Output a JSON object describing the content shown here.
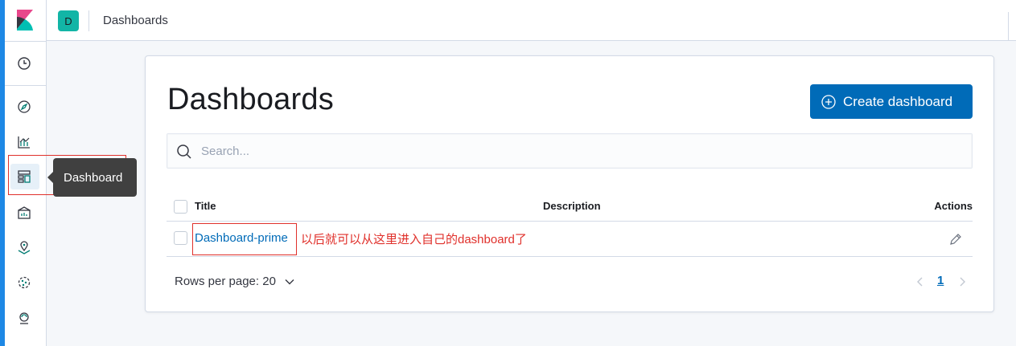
{
  "header": {
    "space_avatar_letter": "D",
    "breadcrumb": "Dashboards"
  },
  "nav": {
    "tooltip": "Dashboard",
    "icons": [
      "clock-icon",
      "compass-icon",
      "visualize-icon",
      "dashboard-icon",
      "canvas-icon",
      "maps-icon",
      "ml-icon",
      "metrics-icon"
    ]
  },
  "main": {
    "title": "Dashboards",
    "create_button": "Create dashboard",
    "search_placeholder": "Search...",
    "table": {
      "columns": [
        "Title",
        "Description",
        "Actions"
      ],
      "rows": [
        {
          "title": "Dashboard-prime",
          "description": ""
        }
      ]
    },
    "annotation": "以后就可以从这里进入自己的dashboard了",
    "rows_per_page": "Rows per page: 20",
    "page_number": "1"
  },
  "colors": {
    "primary": "#006bb8",
    "nav_accent": "#1e88e5",
    "avatar": "#12b5a6",
    "annotation_red": "#e0302b"
  }
}
